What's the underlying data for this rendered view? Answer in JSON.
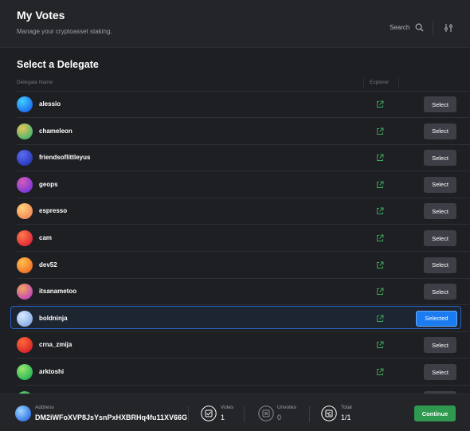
{
  "header": {
    "title": "My Votes",
    "subtitle": "Manage your cryptoasset staking.",
    "search_label": "Search"
  },
  "section_title": "Select a Delegate",
  "columns": {
    "name": "Delegate Name",
    "explorer": "Explorer"
  },
  "delegates": [
    {
      "name": "alessio",
      "button": "Select",
      "colors": [
        "#3fd0ff",
        "#1e6ef0"
      ]
    },
    {
      "name": "chameleon",
      "button": "Select",
      "colors": [
        "#e8c45a",
        "#4cb86e"
      ]
    },
    {
      "name": "friendsoflittleyus",
      "button": "Select",
      "colors": [
        "#5a6cf5",
        "#2a3ab8"
      ]
    },
    {
      "name": "geops",
      "button": "Select",
      "colors": [
        "#d95bb5",
        "#7d3ad8"
      ]
    },
    {
      "name": "espresso",
      "button": "Select",
      "colors": [
        "#ffd27a",
        "#f28c5a"
      ]
    },
    {
      "name": "cam",
      "button": "Select",
      "colors": [
        "#ff7a4a",
        "#e02a3a"
      ]
    },
    {
      "name": "dev52",
      "button": "Select",
      "colors": [
        "#ffc14a",
        "#f2722a"
      ]
    },
    {
      "name": "itsanametoo",
      "button": "Select",
      "colors": [
        "#f2a65a",
        "#c44ab8"
      ]
    },
    {
      "name": "boldninja",
      "button": "Selected",
      "selected": true,
      "colors": [
        "#d8eaff",
        "#8ab0e8"
      ]
    },
    {
      "name": "crna_zmija",
      "button": "Select",
      "colors": [
        "#ff6a3a",
        "#d8262a"
      ]
    },
    {
      "name": "arktoshi",
      "button": "Select",
      "colors": [
        "#9ae86a",
        "#2ab85a"
      ]
    },
    {
      "name": "",
      "button": "",
      "colors": [
        "#6ad87a",
        "#2a9a4a"
      ]
    }
  ],
  "footer": {
    "address_label": "Address",
    "address": "DM2iWFoXVP8JsYsnPxHXBRHq4fu11XV66G",
    "votes_label": "Votes",
    "votes": "1",
    "unvotes_label": "Unvotes",
    "unvotes": "0",
    "total_label": "Total",
    "total": "1/1",
    "continue_label": "Continue"
  },
  "colors": {
    "background": "#1e1f23",
    "panel": "#242529",
    "select_button": "#3c3f46",
    "selected_button": "#1a7cf0",
    "continue_button": "#2f9a4f",
    "external_link_icon": "#3fa85c"
  }
}
